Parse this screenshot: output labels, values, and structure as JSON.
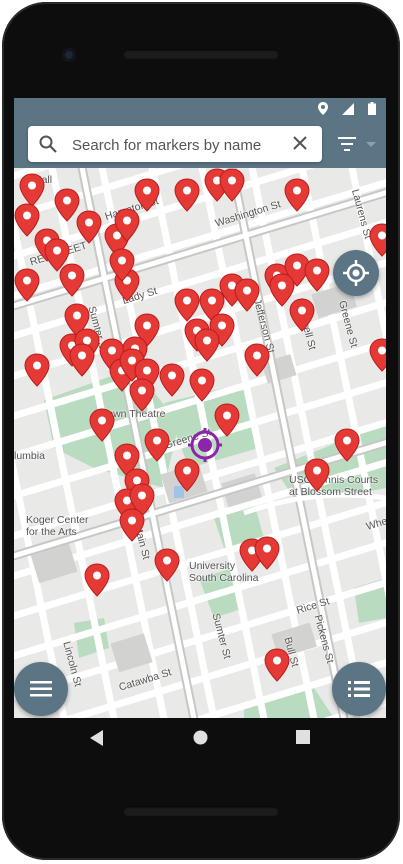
{
  "search": {
    "placeholder": "Search for markers by name"
  },
  "colors": {
    "appbar": "#5b7585",
    "marker": "#e53935",
    "user_location": "#8e24aa"
  },
  "icons": {
    "search": "search-icon",
    "clear": "close-icon",
    "filter": "filter-icon",
    "locate": "gps-fixed-icon",
    "menu": "menu-icon",
    "list": "list-icon"
  },
  "map": {
    "labels": {
      "hampton": "Hampton St",
      "washington": "Washington St",
      "lady": "Lady St",
      "laurens": "Laurens St",
      "jefferson": "Jefferson St",
      "barnwell": "Barnwell St",
      "greene": "Greene St",
      "sumter": "Sumter St",
      "main": "Main St",
      "lincoln": "Lincoln St",
      "catawba": "Catawba St",
      "rice": "Rice St",
      "pickens": "Pickens St",
      "bull": "Bull St",
      "assembly_fragment": "RE STREET",
      "town_theatre": "Town Theatre",
      "columbia": "lumbia",
      "koger": "Koger Center\nfor the Arts",
      "usc": "University\nSouth Carolina",
      "usc_courts": "USC Tennis Courts\nat Blossom Street",
      "greene_street": "Greene St",
      "wheat": "Whe",
      "hall": "Hall"
    }
  }
}
